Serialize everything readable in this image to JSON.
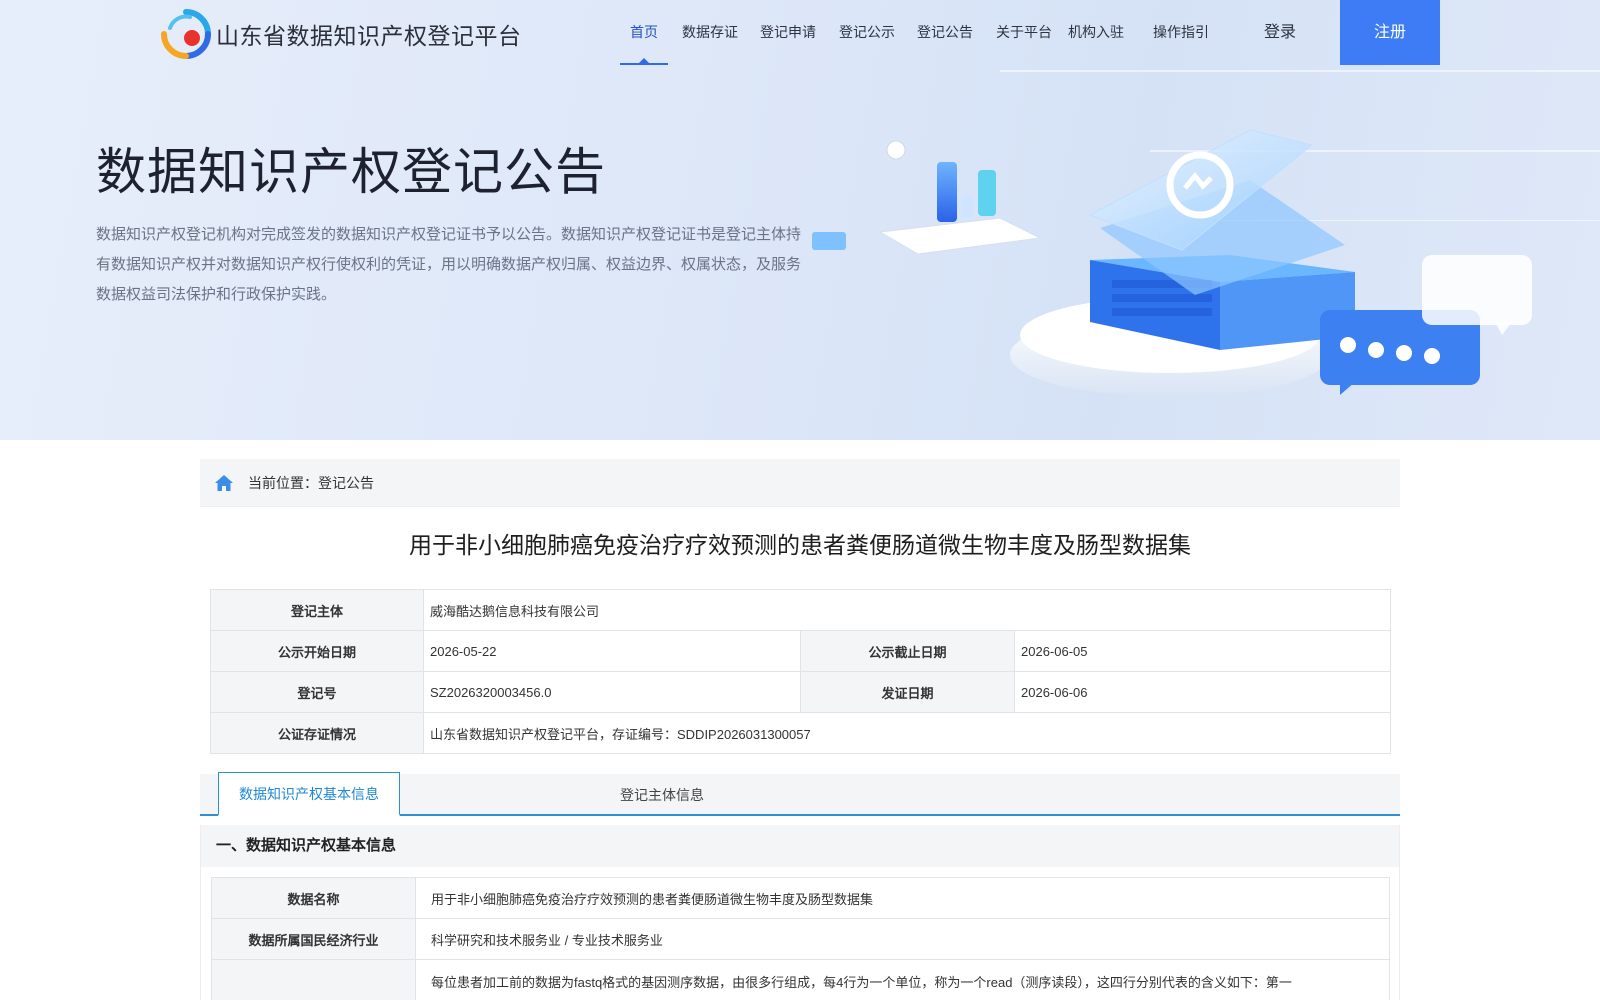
{
  "header": {
    "site_title": "山东省数据知识产权登记平台",
    "nav": [
      {
        "label": "首页",
        "active": true
      },
      {
        "label": "数据存证",
        "active": false
      },
      {
        "label": "登记申请",
        "active": false
      },
      {
        "label": "登记公示",
        "active": false
      },
      {
        "label": "登记公告",
        "active": false
      },
      {
        "label": "关于平台",
        "active": false
      },
      {
        "label": "机构入驻",
        "active": false
      },
      {
        "label": "操作指引",
        "active": false
      }
    ],
    "login_label": "登录",
    "register_label": "注册"
  },
  "hero": {
    "title": "数据知识产权登记公告",
    "description": "数据知识产权登记机构对完成签发的数据知识产权登记证书予以公告。数据知识产权登记证书是登记主体持有数据知识产权并对数据知识产权行使权利的凭证，用以明确数据产权归属、权益边界、权属状态，及服务数据权益司法保护和行政保护实践。"
  },
  "breadcrumb": {
    "text": "当前位置：登记公告"
  },
  "document": {
    "title": "用于非小细胞肺癌免疫治疗疗效预测的患者粪便肠道微生物丰度及肠型数据集"
  },
  "summary": {
    "subject_label": "登记主体",
    "subject_value": "威海酷达鹅信息科技有限公司",
    "start_label": "公示开始日期",
    "start_value": "2026-05-22",
    "end_label": "公示截止日期",
    "end_value": "2026-06-05",
    "regno_label": "登记号",
    "regno_value": "SZ2026320003456.0",
    "issue_label": "发证日期",
    "issue_value": "2026-06-06",
    "notary_label": "公证存证情况",
    "notary_value": "山东省数据知识产权登记平台，存证编号：SDDIP2026031300057"
  },
  "tabs": [
    {
      "label": "数据知识产权基本信息",
      "active": true
    },
    {
      "label": "登记主体信息",
      "active": false
    }
  ],
  "section": {
    "heading": "一、数据知识产权基本信息",
    "rows": [
      {
        "label": "数据名称",
        "value": "用于非小细胞肺癌免疫治疗疗效预测的患者粪便肠道微生物丰度及肠型数据集"
      },
      {
        "label": "数据所属国民经济行业",
        "value": "科学研究和技术服务业 / 专业技术服务业"
      },
      {
        "label": "",
        "value": "每位患者加工前的数据为fastq格式的基因测序数据，由很多行组成，每4行为一个单位，称为一个read（测序读段），这四行分别代表的含义如下：第一"
      }
    ]
  },
  "colors": {
    "accent": "#3d7cf5",
    "tab_accent": "#2e8fd6",
    "label_bg": "#f4f5f7"
  }
}
